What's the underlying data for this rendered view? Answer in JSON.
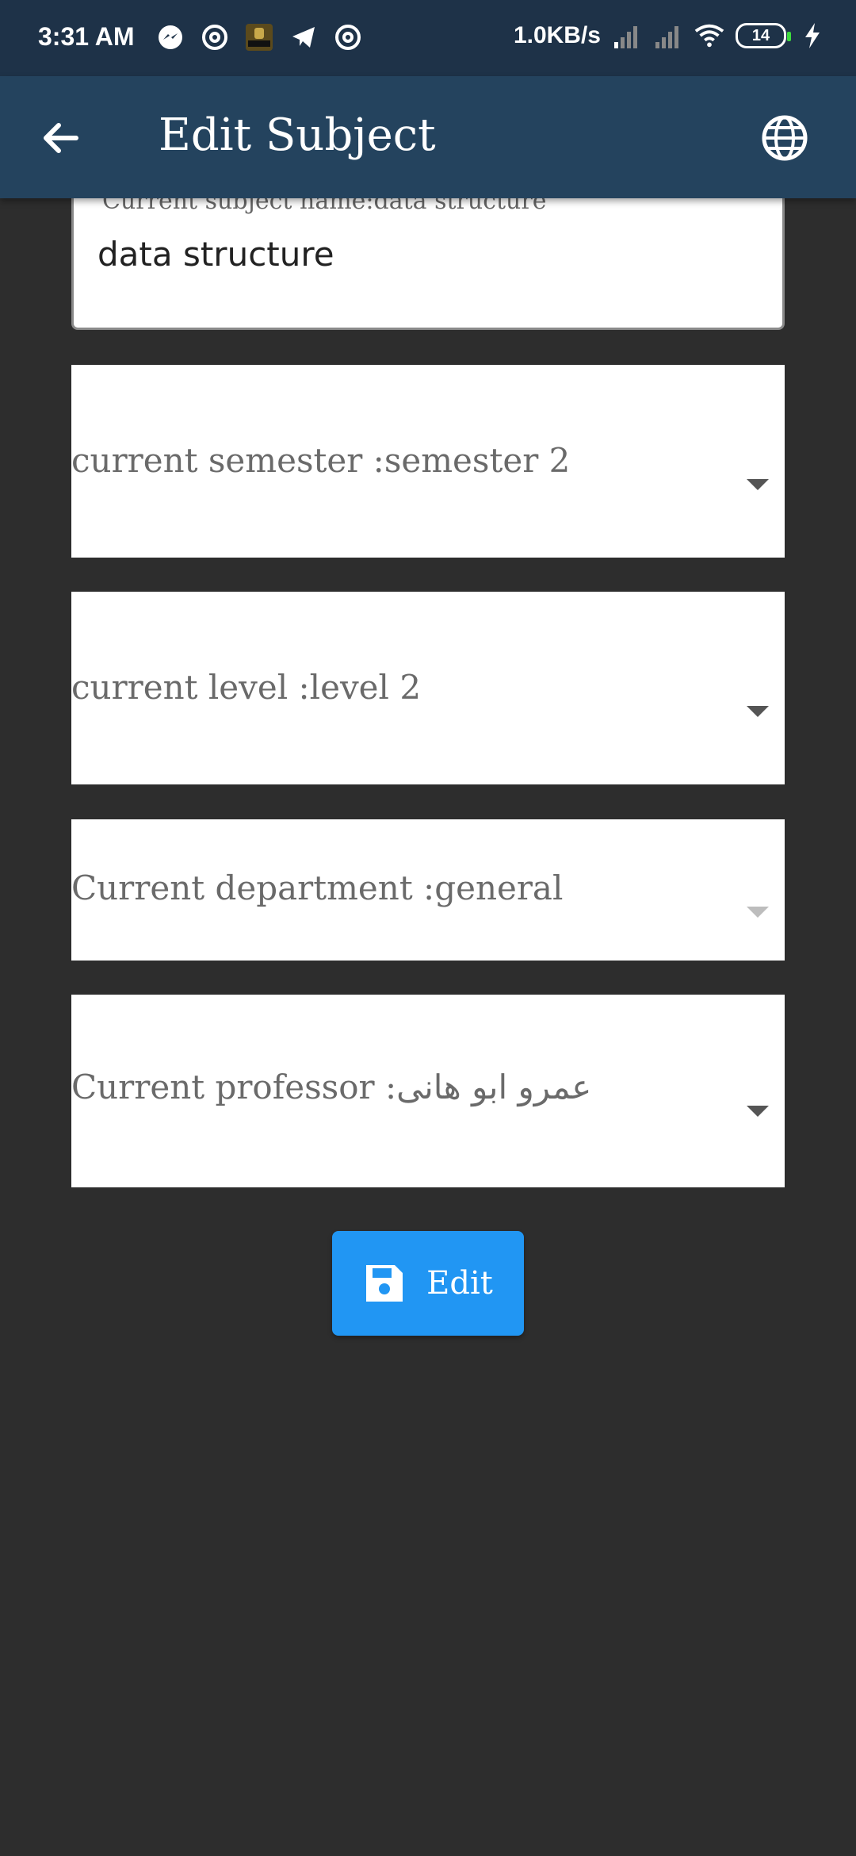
{
  "status_bar": {
    "time": "3:31 AM",
    "net_speed": "1.0KB/s",
    "battery": "14",
    "left_icons": [
      "messenger-icon",
      "at-sign-icon",
      "call-of-duty-app-icon",
      "telegram-icon",
      "at-sign-icon"
    ],
    "right_icons": [
      "signal-icon",
      "signal-icon",
      "wifi-icon",
      "battery-icon",
      "charging-bolt-icon"
    ]
  },
  "app_bar": {
    "title": "Edit Subject",
    "back_icon": "arrow-left-icon",
    "language_icon": "globe-icon"
  },
  "form": {
    "subject_name": {
      "label": "Current subject name:data structure",
      "value": "data structure"
    },
    "semester": {
      "label": "current semester :semester 2"
    },
    "level": {
      "label": "current level :level 2"
    },
    "department": {
      "label": "Current department :general",
      "enabled": false
    },
    "professor": {
      "label": "Current professor :عمرو ابو هانى"
    }
  },
  "edit_button": {
    "label": "Edit",
    "icon": "floppy-disk-icon"
  },
  "colors": {
    "status_bar": "#1e3248",
    "app_bar": "#24435e",
    "background": "#2d2d2d",
    "button": "#2196f3"
  }
}
